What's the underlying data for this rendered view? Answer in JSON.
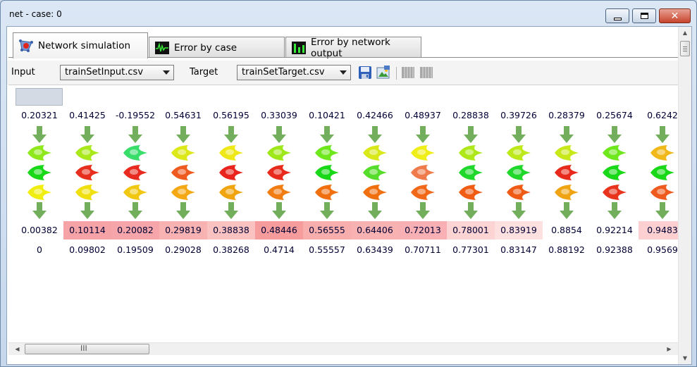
{
  "window": {
    "title": "net - case: 0"
  },
  "tabs": [
    {
      "label": "Network simulation",
      "icon": "network-icon",
      "active": true
    },
    {
      "label": "Error by case",
      "icon": "waveform-icon",
      "active": false
    },
    {
      "label": "Error by network output",
      "icon": "bar-meter-icon",
      "active": false
    }
  ],
  "toolbar": {
    "input_label": "Input",
    "input_value": "trainSetInput.csv",
    "target_label": "Target",
    "target_value": "trainSetTarget.csv",
    "buttons": [
      "save-icon",
      "image-export-icon",
      "grid-icon",
      "grid-alt-icon"
    ]
  },
  "cases": [
    {
      "input": "0.20321",
      "output": "0.00382",
      "target": "0",
      "neurons": [
        "#8ee81c",
        "#18d818",
        "#f0ee10"
      ]
    },
    {
      "input": "0.41425",
      "output": "0.10114",
      "target": "0.09802",
      "neurons": [
        "#a9e81a",
        "#e82e1c",
        "#f0e010"
      ]
    },
    {
      "input": "-0.19552",
      "output": "0.20082",
      "target": "0.19509",
      "neurons": [
        "#38dd6a",
        "#e82a20",
        "#f0c812"
      ]
    },
    {
      "input": "0.54631",
      "output": "0.29819",
      "target": "0.29028",
      "neurons": [
        "#dde818",
        "#ef5a1e",
        "#f4a814"
      ]
    },
    {
      "input": "0.56195",
      "output": "0.38838",
      "target": "0.38268",
      "neurons": [
        "#eee818",
        "#e8241c",
        "#f0a410"
      ]
    },
    {
      "input": "0.33039",
      "output": "0.48446",
      "target": "0.4714",
      "neurons": [
        "#9ee81a",
        "#e82a1c",
        "#f07c12"
      ]
    },
    {
      "input": "0.10421",
      "output": "0.56555",
      "target": "0.55557",
      "neurons": [
        "#6ee81c",
        "#18d818",
        "#f07010"
      ]
    },
    {
      "input": "0.42466",
      "output": "0.64406",
      "target": "0.63439",
      "neurons": [
        "#d8e818",
        "#56dc2a",
        "#f07010"
      ]
    },
    {
      "input": "0.48937",
      "output": "0.72013",
      "target": "0.70711",
      "neurons": [
        "#f0ee18",
        "#ef7a4c",
        "#f06818"
      ]
    },
    {
      "input": "0.28838",
      "output": "0.78001",
      "target": "0.77301",
      "neurons": [
        "#aee81a",
        "#20d82c",
        "#f05c14"
      ]
    },
    {
      "input": "0.39726",
      "output": "0.83919",
      "target": "0.83147",
      "neurons": [
        "#bde81a",
        "#20d82c",
        "#ef5a14"
      ]
    },
    {
      "input": "0.28379",
      "output": "0.8854",
      "target": "0.88192",
      "neurons": [
        "#c8e81a",
        "#e82a1c",
        "#f0a414"
      ]
    },
    {
      "input": "0.25674",
      "output": "0.92214",
      "target": "0.92388",
      "neurons": [
        "#6ee81c",
        "#18d818",
        "#e8341c"
      ]
    },
    {
      "input": "0.6242",
      "output": "0.9483",
      "target": "0.9569",
      "neurons": [
        "#f0b818",
        "#18d818",
        "#ef5a1e"
      ]
    }
  ],
  "colors": {
    "arrow": "#72ae5c",
    "output_cells": [
      "#ffffff",
      "#f6a3a8",
      "#f6a6aa",
      "#f8b2b2",
      "#fbc2c2",
      "#f79c9c",
      "#f9aeae",
      "#f9b2b2",
      "#f8b0b4",
      "#fcd4d4",
      "#fde0e0",
      "#ffffff",
      "#ffffff",
      "#fcd0d0"
    ]
  },
  "hscroll_grip": "III"
}
